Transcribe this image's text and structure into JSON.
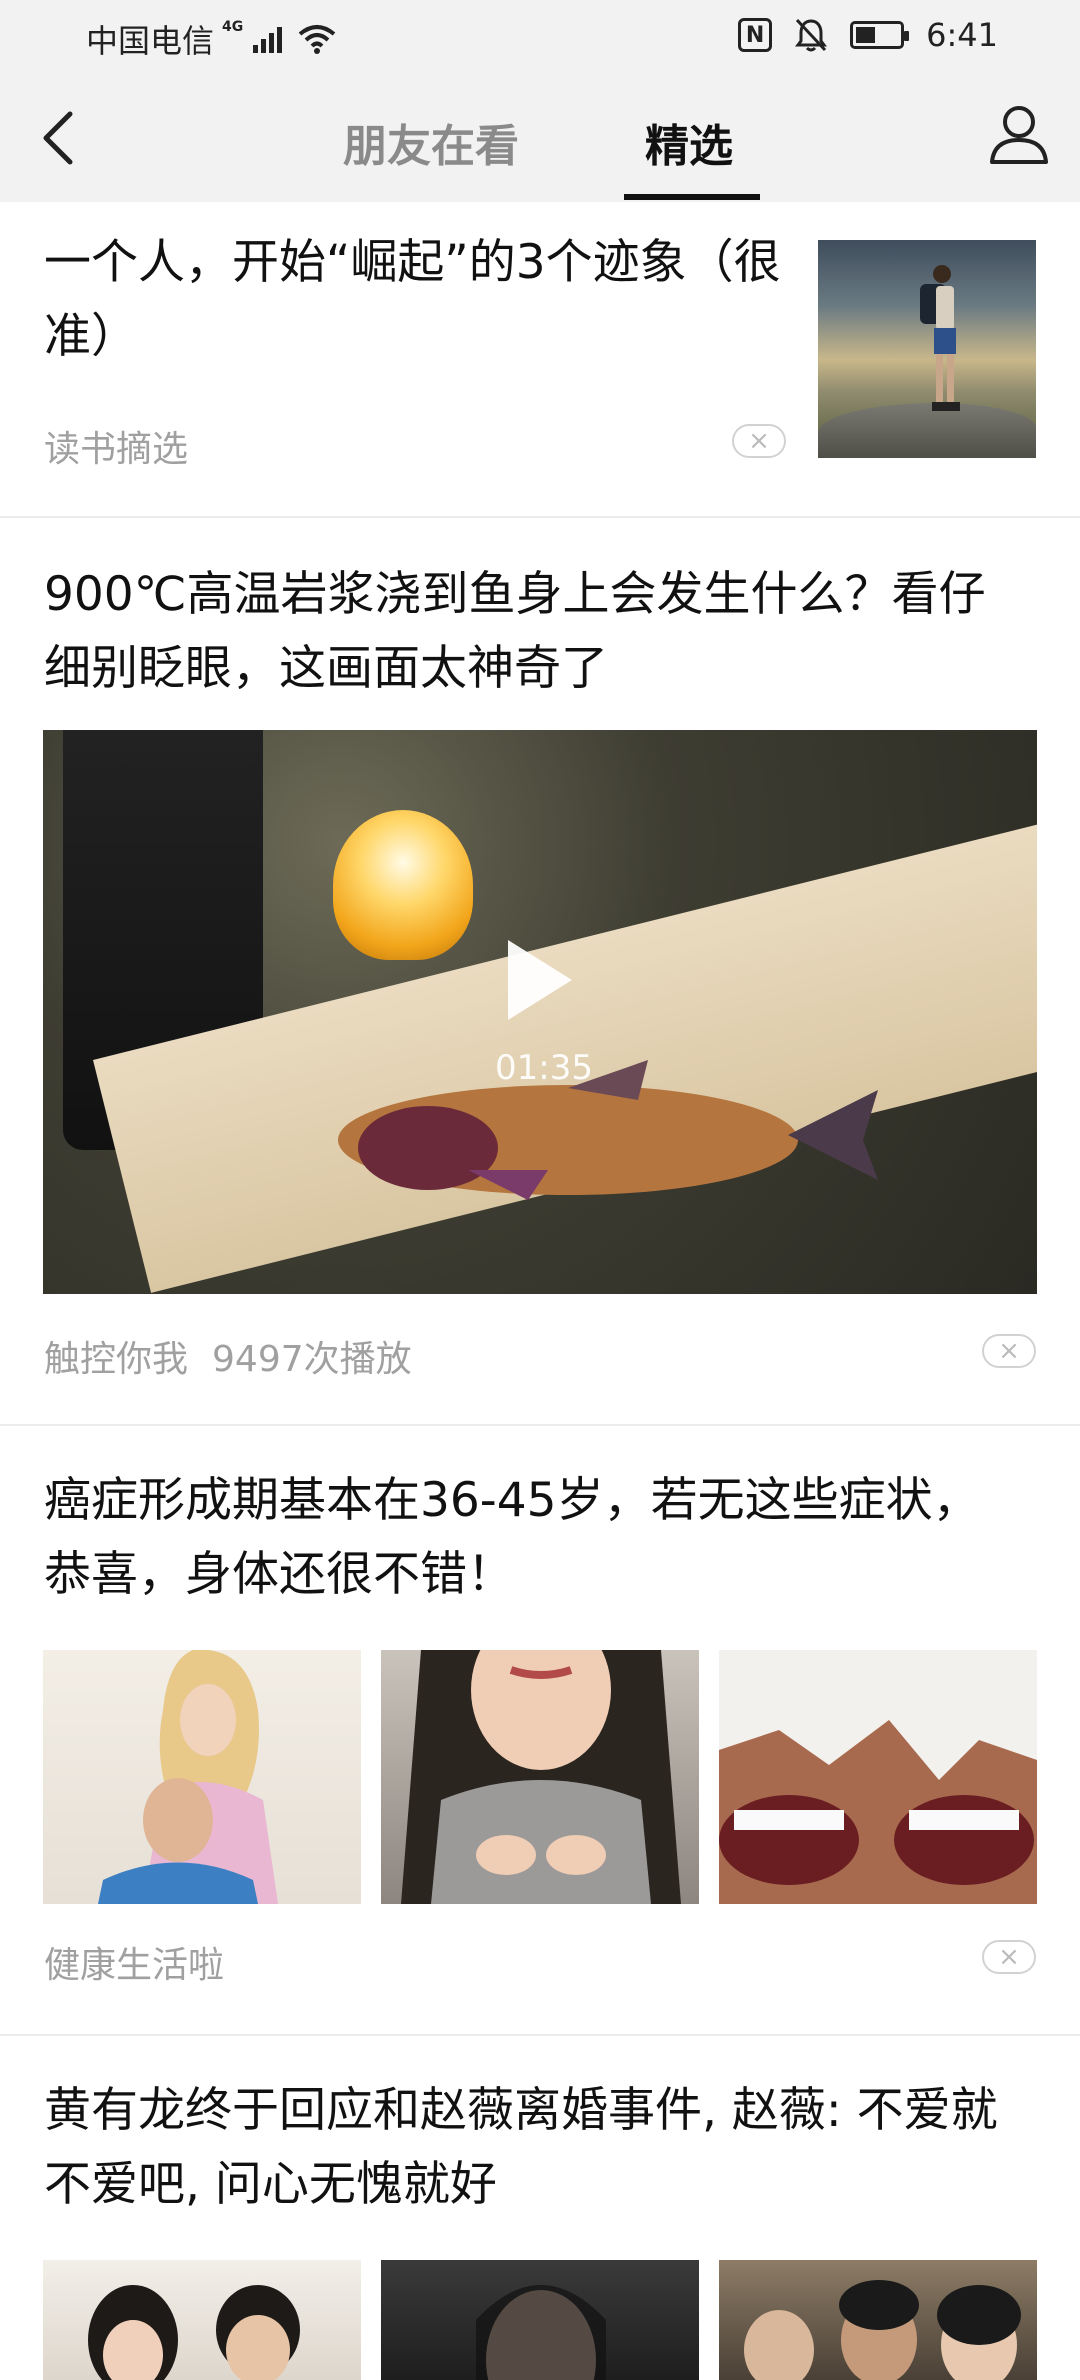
{
  "status_bar": {
    "carrier": "中国电信",
    "network": "4G",
    "time": "6:41",
    "nfc_label": "N"
  },
  "nav": {
    "tabs": [
      {
        "label": "朋友在看",
        "active": false
      },
      {
        "label": "精选",
        "active": true
      }
    ]
  },
  "articles": [
    {
      "title_line1": "一个人，开始“崛起”的3个迹象（很",
      "title_line2": "准）",
      "source": "读书摘选",
      "image_icon": "hiker-on-mountain-image"
    },
    {
      "title_line1": "900℃高温岩浆浇到鱼身上会发生什么？看仔",
      "title_line2": "细别眨眼，这画面太神奇了",
      "duration": "01:35",
      "source": "触控你我",
      "plays": "9497次播放"
    },
    {
      "title_line1": "癌症形成期基本在36-45岁，若无这些症状，",
      "title_line2": "恭喜，身体还很不错！",
      "source": "健康生活啦"
    },
    {
      "title_line1": "黄有龙终于回应和赵薇离婚事件, 赵薇: 不爱就",
      "title_line2": "不爱吧, 问心无愧就好"
    }
  ],
  "close_glyph": "×"
}
